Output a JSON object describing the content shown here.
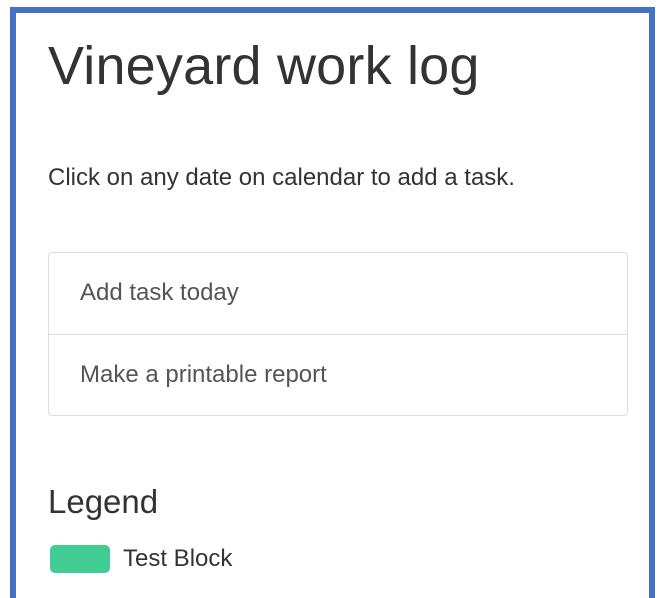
{
  "page": {
    "title": "Vineyard work log",
    "instructions": "Click on any date on calendar to add a task."
  },
  "actions": [
    {
      "label": "Add task today"
    },
    {
      "label": "Make a printable report"
    }
  ],
  "legend": {
    "heading": "Legend",
    "items": [
      {
        "label": "Test Block",
        "color": "#41cc94"
      }
    ]
  },
  "colors": {
    "frame_border": "#4472c4",
    "text": "#333333",
    "list_text": "#555555",
    "list_border": "#dddddd"
  }
}
